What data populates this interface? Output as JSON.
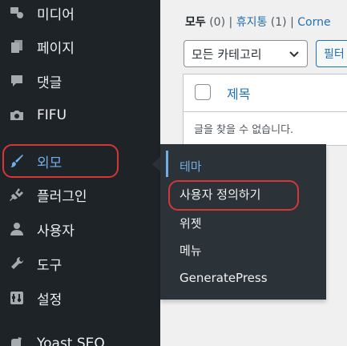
{
  "sidebar": {
    "items": [
      {
        "label": "미디어",
        "icon": "media-icon"
      },
      {
        "label": "페이지",
        "icon": "pages-icon"
      },
      {
        "label": "댓글",
        "icon": "comments-icon"
      },
      {
        "label": "FIFU",
        "icon": "camera-icon"
      },
      {
        "label": "외모",
        "icon": "appearance-brush-icon"
      },
      {
        "label": "플러그인",
        "icon": "plugins-icon"
      },
      {
        "label": "사용자",
        "icon": "users-icon"
      },
      {
        "label": "도구",
        "icon": "tools-wrench-icon"
      },
      {
        "label": "설정",
        "icon": "settings-icon"
      },
      {
        "label": "Yoast SEO",
        "icon": "yoast-icon"
      }
    ]
  },
  "flyout": {
    "items": [
      {
        "label": "테마"
      },
      {
        "label": "사용자 정의하기"
      },
      {
        "label": "위젯"
      },
      {
        "label": "메뉴"
      },
      {
        "label": "GeneratePress"
      }
    ]
  },
  "main": {
    "filters": {
      "all_label": "모두",
      "all_count": "(0)",
      "separator": "|",
      "trash_label": "휴지통",
      "trash_count": "(1)",
      "separator2": "|",
      "cut_label": "Corne"
    },
    "category_select": "모든 카테고리",
    "filter_button": "필터",
    "table": {
      "title_column": "제목",
      "empty_message": "글을 찾을 수 없습니다."
    }
  },
  "colors": {
    "sidebar_bg": "#1d2327",
    "flyout_bg": "#2c3338",
    "accent": "#72aee6",
    "link": "#2271b1",
    "highlight": "#d63638"
  }
}
